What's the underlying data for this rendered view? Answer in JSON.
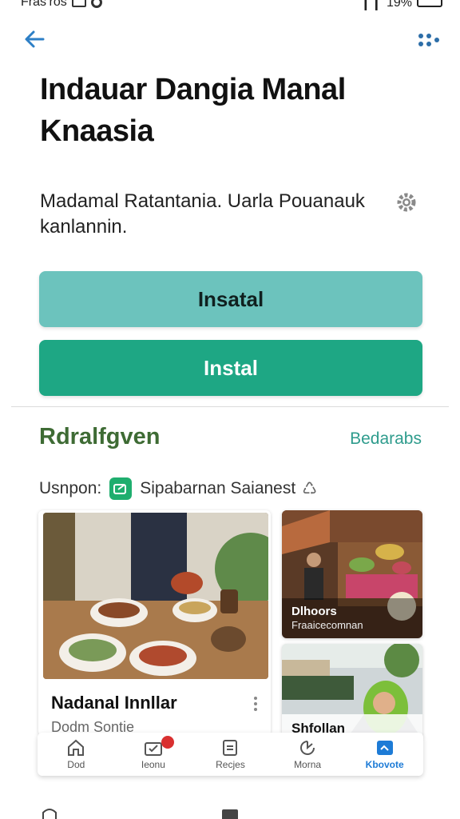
{
  "status_bar": {
    "left_text": "Fras’ros",
    "right_text": "19%"
  },
  "app": {
    "title": "Indauar Dangia Manal Knaasia",
    "description": "Madamal Ratantania. Uarla Pouanauk kanlannin.",
    "secondary_button": "Insatal",
    "primary_button": "Instal"
  },
  "section": {
    "title": "Rdralfgven",
    "link": "Bedarabs",
    "source_label": "Usnpon:",
    "source_name": "Sipabarnan Saianest"
  },
  "cards": {
    "main": {
      "name": "Nadanal Innllar",
      "sub": "Dodm Sontie"
    },
    "side1": {
      "label": "Dlhoors",
      "sublabel": "Fraaicecomnan"
    },
    "side2": {
      "label": "Shfollan"
    }
  },
  "bottom_nav": [
    {
      "label": "Dod",
      "icon": "home-icon"
    },
    {
      "label": "Ieonu",
      "icon": "folder-check-icon"
    },
    {
      "label": "Recjes",
      "icon": "document-icon"
    },
    {
      "label": "Morna",
      "icon": "refresh-icon"
    },
    {
      "label": "Kbovote",
      "icon": "app-icon",
      "active": true
    }
  ],
  "colors": {
    "primary": "#1ea784",
    "secondary": "#6cc3bd",
    "accent_blue": "#2d7fc6",
    "section_green": "#3e6b34",
    "link_teal": "#2f9c8d"
  }
}
